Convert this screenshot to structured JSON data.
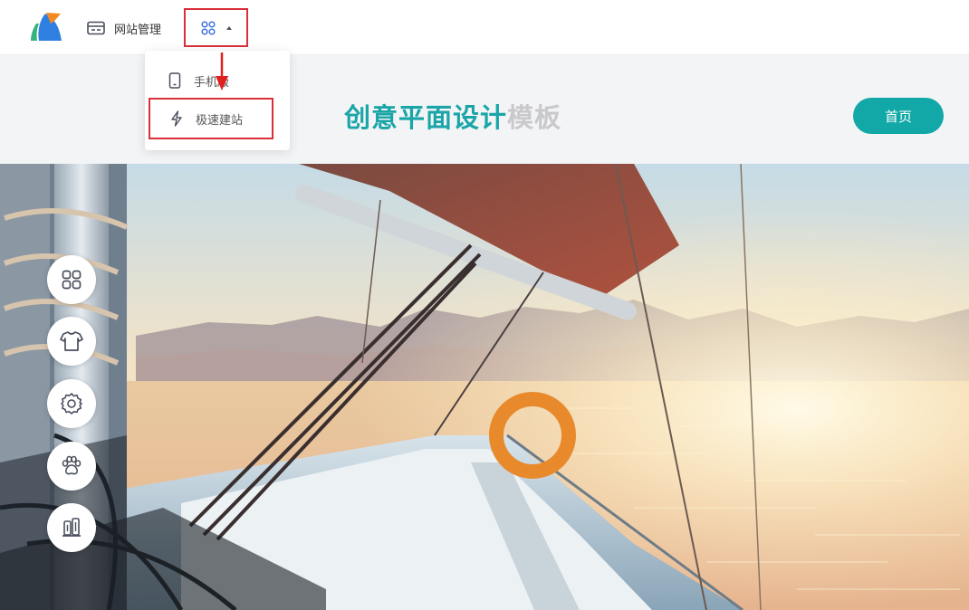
{
  "topbar": {
    "logo": "brand-logo",
    "site_management_label": "网站管理",
    "site_management_icon": "card-icon",
    "apps_icon": "apps-grid-icon"
  },
  "dropdown": {
    "items": [
      {
        "label": "手机版",
        "icon": "mobile-icon"
      },
      {
        "label": "极速建站",
        "icon": "lightning-icon"
      }
    ]
  },
  "header": {
    "title_part1": "创意平面设计",
    "title_part2": "模板",
    "home_button": "首页"
  },
  "side_toolbar": [
    "apps-grid-icon",
    "shirt-icon",
    "gear-icon",
    "paw-icon",
    "building-icon"
  ],
  "colors": {
    "accent": "#11a8a7",
    "title_teal": "#1aa5a8",
    "highlight_red": "#d9303a"
  }
}
